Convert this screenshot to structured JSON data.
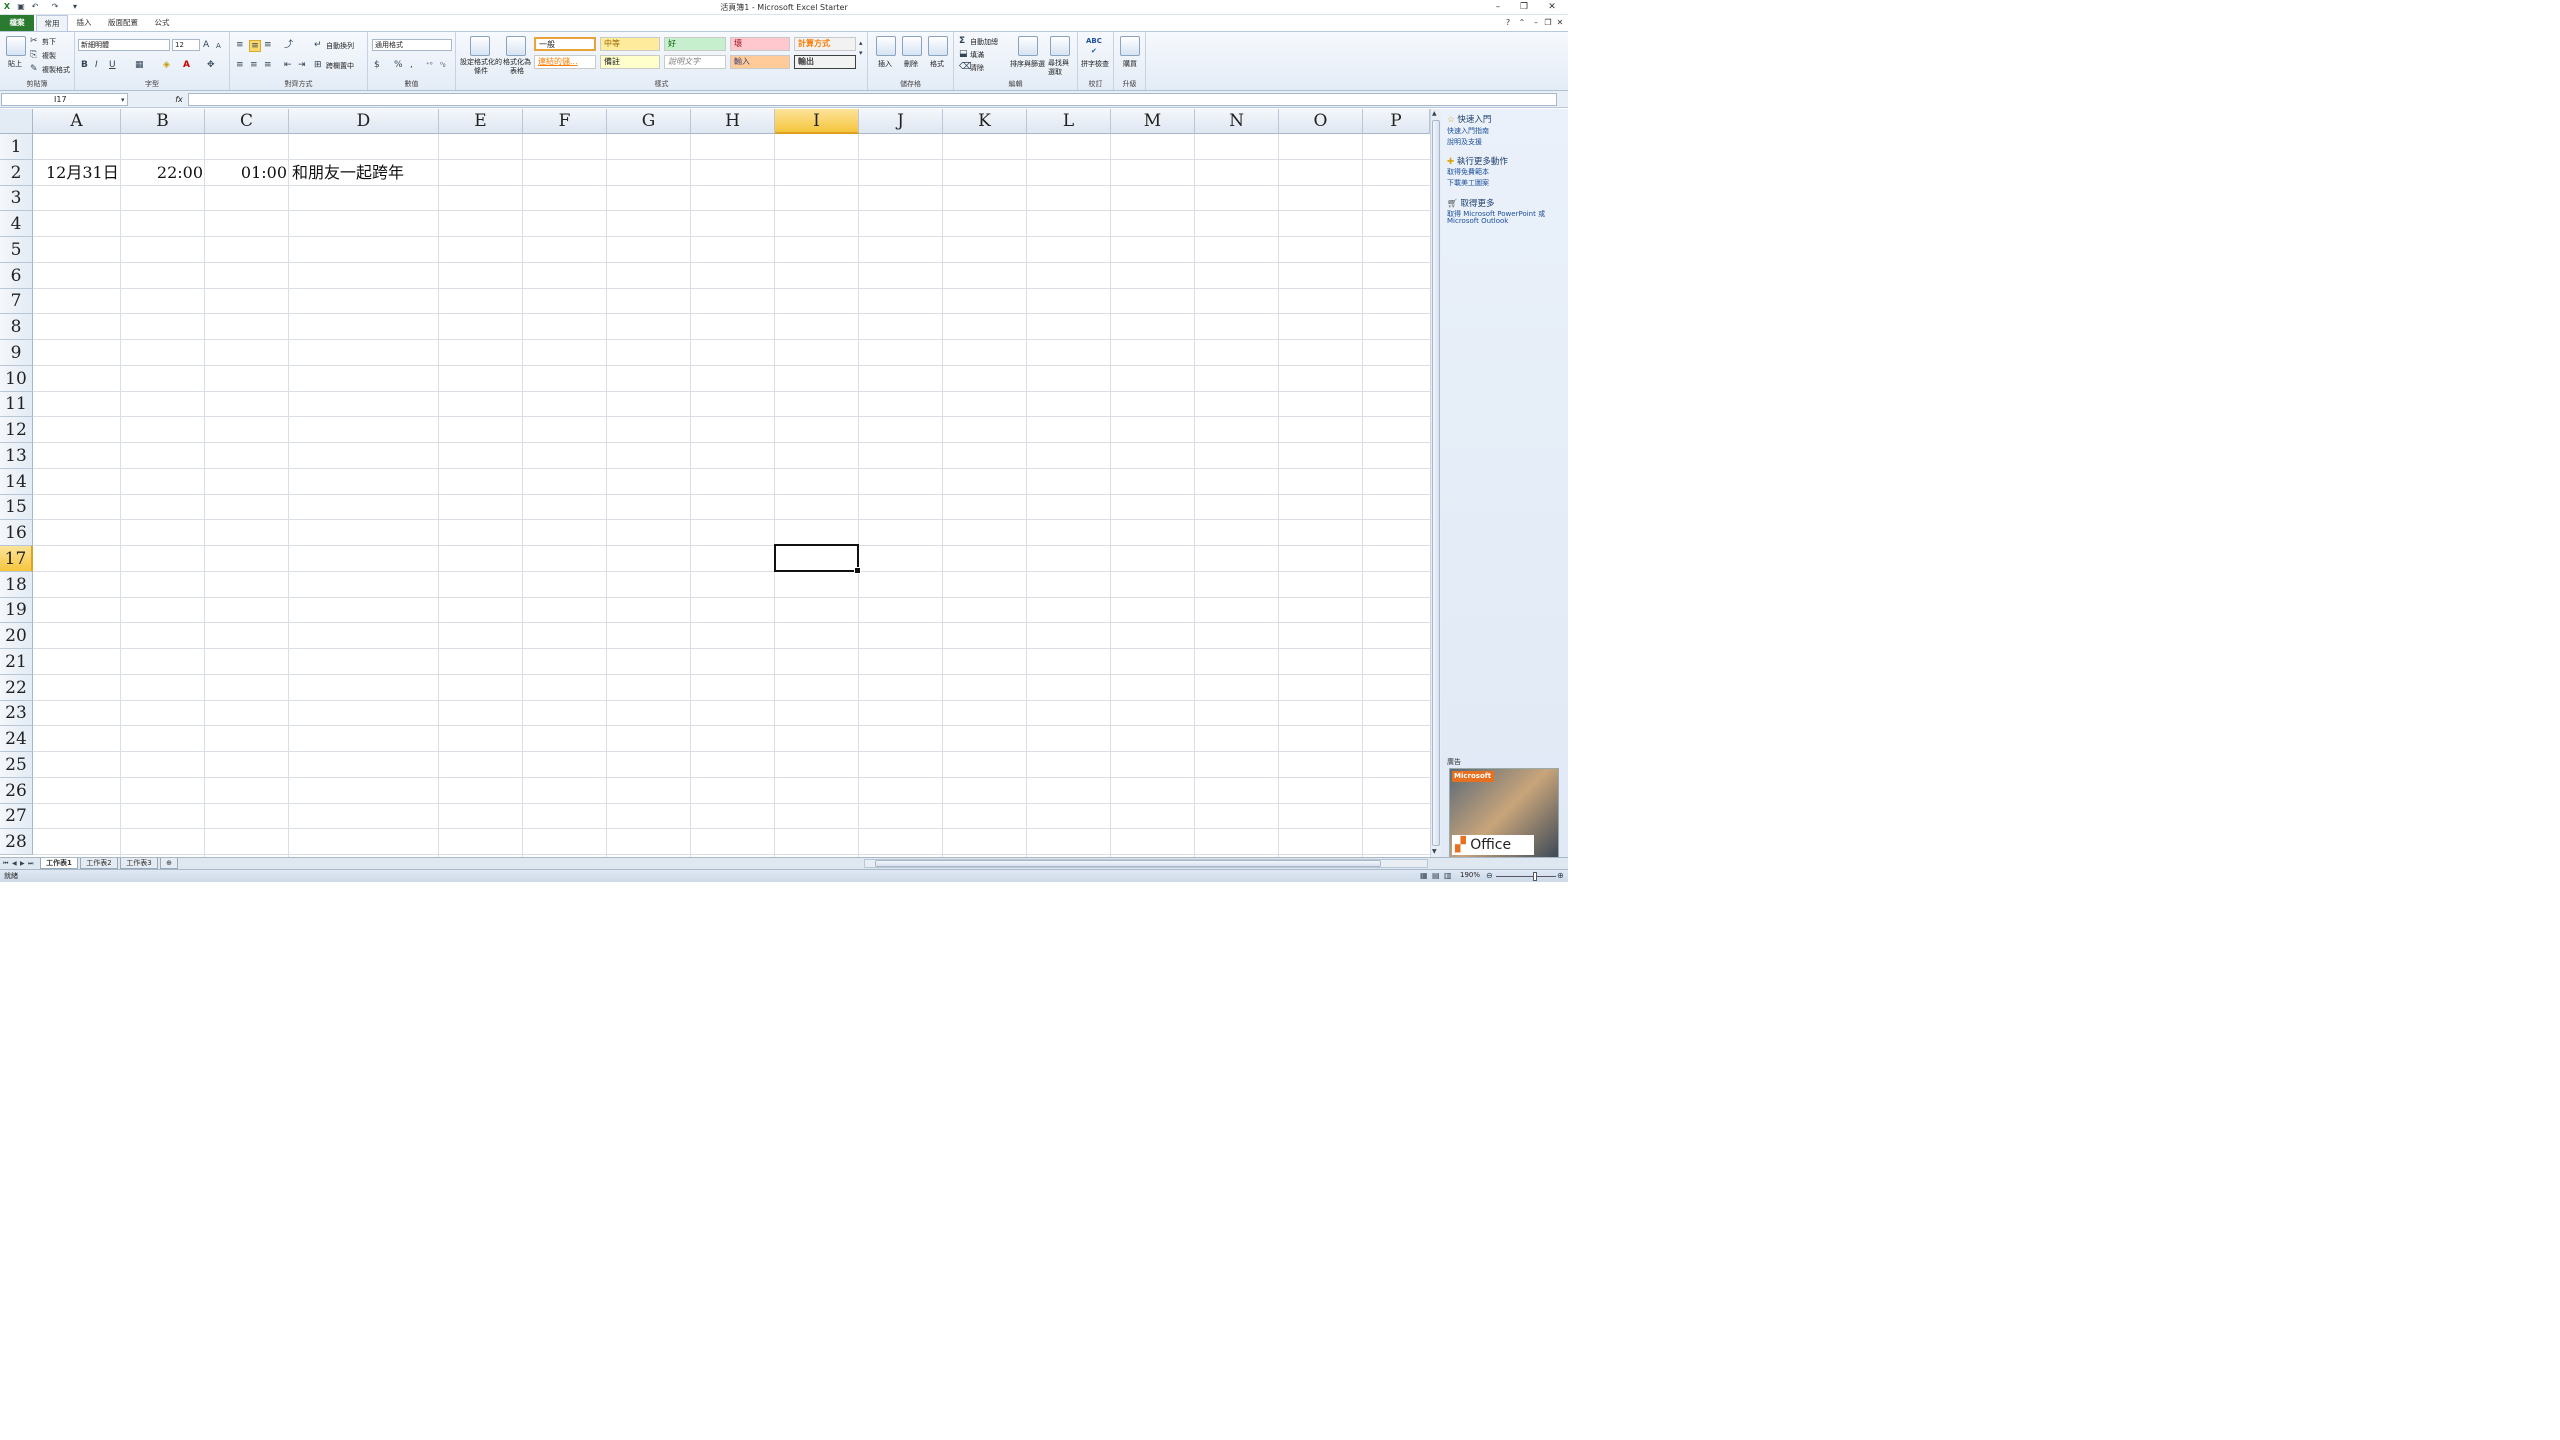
{
  "window": {
    "title": "活頁簿1 - Microsoft Excel Starter"
  },
  "quick_access": [
    "save-icon",
    "undo-icon",
    "redo-icon",
    "customize-icon"
  ],
  "tabs": [
    {
      "label": "檔案"
    },
    {
      "label": "常用"
    },
    {
      "label": "插入"
    },
    {
      "label": "版面配置"
    },
    {
      "label": "公式"
    }
  ],
  "ribbon": {
    "clipboard": {
      "paste": "貼上",
      "cut": "剪下",
      "copy": "複製",
      "format_painter": "複製格式",
      "label": "剪貼簿"
    },
    "font": {
      "name": "新細明體",
      "size": "12",
      "label": "字型",
      "bold": "B",
      "italic": "I",
      "underline": "U"
    },
    "alignment": {
      "wrap": "自動換列",
      "merge": "跨欄置中",
      "label": "對齊方式"
    },
    "number": {
      "format": "通用格式",
      "currency": "$",
      "percent": "%",
      "comma": ",",
      "label": "數值"
    },
    "styles": {
      "conditional": "設定格式化的條件",
      "table": "格式化為表格",
      "cells": [
        "一般",
        "中等",
        "好",
        "壞",
        "計算方式",
        "連結的儲...",
        "備註",
        "說明文字",
        "輸入",
        "輸出"
      ],
      "label": "樣式"
    },
    "cells_group": {
      "insert": "插入",
      "delete": "刪除",
      "format": "格式",
      "label": "儲存格"
    },
    "editing": {
      "autosum": "自動加總",
      "fill": "填滿",
      "clear": "清除",
      "sort": "排序與篩選",
      "find": "尋找與選取",
      "label": "編輯"
    },
    "proofing": {
      "spell": "拼字檢查",
      "label": "校訂"
    },
    "upgrade": {
      "buy": "購買",
      "label": "升級"
    }
  },
  "formula_bar": {
    "name_box": "I17",
    "fx": "fx",
    "value": ""
  },
  "grid": {
    "columns": [
      "A",
      "B",
      "C",
      "D",
      "E",
      "F",
      "G",
      "H",
      "I",
      "J",
      "K",
      "L",
      "M",
      "N",
      "O",
      "P"
    ],
    "selected_column": "I",
    "selected_row": "17",
    "rows": [
      "1",
      "2",
      "3",
      "4",
      "5",
      "6",
      "7",
      "8",
      "9",
      "10",
      "11",
      "12",
      "13",
      "14",
      "15",
      "16",
      "17",
      "18",
      "19",
      "20",
      "21",
      "22",
      "23",
      "24",
      "25",
      "26",
      "27",
      "28"
    ],
    "cells": {
      "A2": "12月31日",
      "B2": "22:00",
      "C2": "01:00",
      "D2": "和朋友一起跨年"
    }
  },
  "side_pane": {
    "sections": [
      {
        "title": "快速入門",
        "links": [
          "快速入門指南",
          "說明及支援"
        ]
      },
      {
        "title": "執行更多動作",
        "links": [
          "取得免費範本",
          "下載美工圖案"
        ]
      },
      {
        "title": "取得更多",
        "links": [
          "取得 Microsoft PowerPoint 或",
          "Microsoft Outlook"
        ]
      }
    ],
    "ad_label": "廣告",
    "ad_logo": "Office",
    "ad_brand": "Microsoft"
  },
  "sheets": [
    "工作表1",
    "工作表2",
    "工作表3"
  ],
  "status": {
    "ready": "就緒",
    "zoom": "190%"
  }
}
